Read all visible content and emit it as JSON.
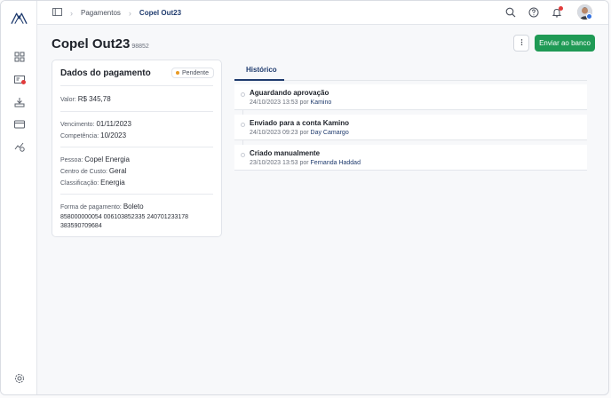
{
  "breadcrumb": {
    "parent": "Pagamentos",
    "current": "Copel Out23"
  },
  "page": {
    "title": "Copel Out23",
    "code": "98852"
  },
  "actions": {
    "send_label": "Enviar ao banco"
  },
  "card": {
    "title": "Dados do pagamento",
    "status": "Pendente",
    "valor_label": "Valor:",
    "valor": "R$ 345,78",
    "vencimento_label": "Vencimento:",
    "vencimento": "01/11/2023",
    "competencia_label": "Competência:",
    "competencia": "10/2023",
    "pessoa_label": "Pessoa:",
    "pessoa": "Copel Energia",
    "centro_label": "Centro de Custo:",
    "centro": "Geral",
    "classificacao_label": "Classificação:",
    "classificacao": "Energia",
    "forma_label": "Forma de pagamento:",
    "forma": "Boleto",
    "barcode": "858000000054 006103852335 240701233178 383590709684"
  },
  "tabs": {
    "historico": "Histórico"
  },
  "history": [
    {
      "title": "Aguardando aprovação",
      "date": "24/10/2023 13:53",
      "by": "por",
      "user": "Kamino"
    },
    {
      "title": "Enviado para a conta Kamino",
      "date": "24/10/2023 09:23",
      "by": "por",
      "user": "Day Camargo"
    },
    {
      "title": "Criado manualmente",
      "date": "23/10/2023 13:53",
      "by": "por",
      "user": "Fernanda Haddad"
    }
  ],
  "colors": {
    "primary": "#1f9a55",
    "accent": "#1f3b6e",
    "pending": "#e89a23",
    "notification": "#e23b3b"
  },
  "icons": [
    "logo-icon",
    "dashboard-icon",
    "payables-icon",
    "receivables-icon",
    "card-icon",
    "investments-icon",
    "settings-icon",
    "layout-icon",
    "search-icon",
    "help-icon",
    "bell-icon",
    "more-vertical-icon"
  ]
}
